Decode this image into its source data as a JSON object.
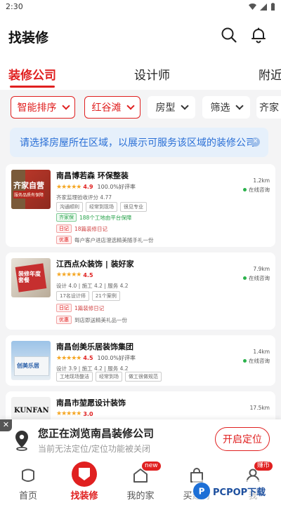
{
  "status": {
    "time": "2:30"
  },
  "header": {
    "title": "找装修"
  },
  "tabs": [
    {
      "label": "装修公司"
    },
    {
      "label": "设计师"
    },
    {
      "label": "附近"
    }
  ],
  "filters": {
    "sort": "智能排序",
    "area": "红谷滩",
    "house_type": "房型",
    "filter": "筛选",
    "more": "齐家"
  },
  "notice": "请选择房屋所在区域，以展示可服务该区域的装修公司",
  "companies": [
    {
      "thumb_title": "齐家自营",
      "thumb_sub": "服务品质有保障",
      "name": "南昌博若森 环保整装",
      "stars": "★★★★★",
      "score": "4.9",
      "praise": "100.0%好评率",
      "sub": "齐家监理验收评分 4.77",
      "tags": [
        "沟通顺利",
        "经常到现场",
        "很见专业"
      ],
      "lines": [
        {
          "badge": "齐家保",
          "badge_color": "green",
          "text": "188个工地由平台保障"
        },
        {
          "badge": "日记",
          "badge_color": "red",
          "text": "18篇装修日记"
        },
        {
          "badge": "优惠",
          "badge_color": "red",
          "text": "每户客户进店澄选精美随手礼一份"
        }
      ],
      "distance": "1.2km",
      "online": "在线咨询"
    },
    {
      "thumb_title": "装修年度套餐",
      "name": "江西点众装饰 | 装好家",
      "stars": "★★★★★",
      "score": "4.5",
      "praise": "",
      "sub": "设计 4.0 | 施工 4.2 | 服务 4.2",
      "tags": [
        "17名设计师",
        "21个案例"
      ],
      "lines": [
        {
          "badge": "日记",
          "badge_color": "red",
          "text": "1篇装修日记"
        },
        {
          "badge": "优惠",
          "badge_color": "red",
          "text": "到店即送精美礼品一份"
        }
      ],
      "distance": "7.9km",
      "online": "在线咨询"
    },
    {
      "thumb_title": "创美乐居",
      "name": "南昌创美乐居装饰集团",
      "stars": "★★★★★",
      "score": "4.5",
      "praise": "100.0%好评率",
      "sub": "设计 3.9 | 施工 4.2 | 服务 4.2",
      "tags": [
        "工地现场整洁",
        "经常到场",
        "做工很做规范"
      ],
      "lines": [],
      "distance": "1.4km",
      "online": "在线咨询"
    },
    {
      "thumb_title": "KUNFAN",
      "name": "南昌市堃愿设计装饰",
      "stars": "★★★★★",
      "score": "3.0",
      "praise": "",
      "sub": "",
      "tags": [],
      "lines": [],
      "distance": "17.5km",
      "online": ""
    }
  ],
  "location_bar": {
    "title": "您正在浏览南昌装修公司",
    "subtitle": "当前无法定位/定位功能被关闭",
    "button": "开启定位"
  },
  "nav": [
    {
      "label": "首页"
    },
    {
      "label": "找装修"
    },
    {
      "label": "我的家",
      "badge": "new"
    },
    {
      "label": "买建材"
    },
    {
      "label": "我",
      "badge": "赚币"
    }
  ],
  "watermark": "PCPOP下载",
  "colors": {
    "accent": "#e02020",
    "notice_text": "#2a6fd6",
    "notice_bg": "#e6f0fb"
  }
}
